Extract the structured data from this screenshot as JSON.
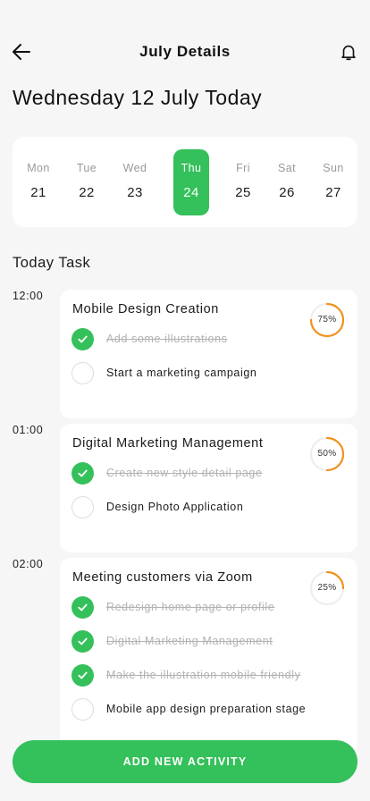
{
  "header": {
    "title": "July Details",
    "back_icon": "arrow-left-icon",
    "bell_icon": "bell-icon"
  },
  "date_heading": "Wednesday 12 July Today",
  "week": [
    {
      "name": "Mon",
      "num": "21",
      "active": false
    },
    {
      "name": "Tue",
      "num": "22",
      "active": false
    },
    {
      "name": "Wed",
      "num": "23",
      "active": false
    },
    {
      "name": "Thu",
      "num": "24",
      "active": true
    },
    {
      "name": "Fri",
      "num": "25",
      "active": false
    },
    {
      "name": "Sat",
      "num": "26",
      "active": false
    },
    {
      "name": "Sun",
      "num": "27",
      "active": false
    }
  ],
  "section_title": "Today Task",
  "tasks": [
    {
      "time": "12:00",
      "title": "Mobile Design Creation",
      "progress": 75,
      "progress_label": "75%",
      "items": [
        {
          "label": "Add some illustrations",
          "done": true
        },
        {
          "label": "Start a marketing campaign",
          "done": false
        }
      ]
    },
    {
      "time": "01:00",
      "title": "Digital Marketing Management",
      "progress": 50,
      "progress_label": "50%",
      "items": [
        {
          "label": "Create new style detail page",
          "done": true
        },
        {
          "label": "Design Photo Application",
          "done": false
        }
      ]
    },
    {
      "time": "02:00",
      "title": "Meeting customers via Zoom",
      "progress": 25,
      "progress_label": "25%",
      "items": [
        {
          "label": "Redesign home page or profile",
          "done": true
        },
        {
          "label": "Digital Marketing Management",
          "done": true
        },
        {
          "label": "Make the illustration mobile friendly",
          "done": true
        },
        {
          "label": "Mobile app design preparation stage",
          "done": false
        }
      ]
    }
  ],
  "add_button": "ADD NEW ACTIVITY",
  "colors": {
    "accent": "#34c05a",
    "progress": "#f0921f",
    "track": "#eeeeee"
  }
}
